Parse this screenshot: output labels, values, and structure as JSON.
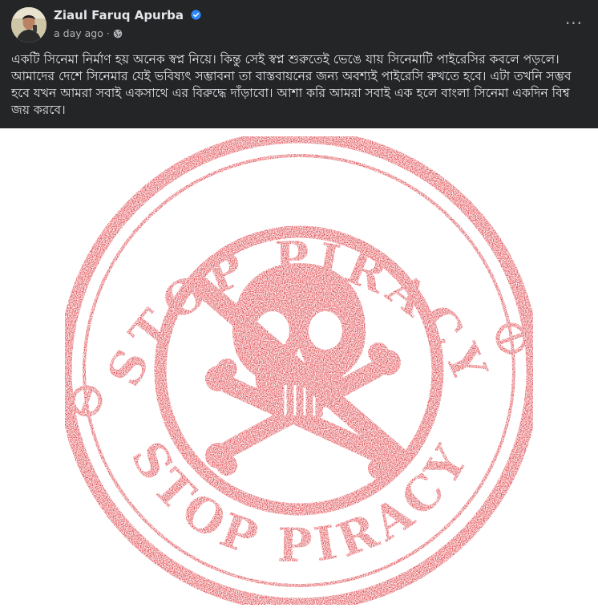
{
  "post": {
    "author": "Ziaul Faruq Apurba",
    "verified_icon": "verified-badge-icon",
    "timestamp": "a day ago",
    "separator": "·",
    "audience_icon": "globe-icon",
    "more_label": "···",
    "text": "একটি সিনেমা নির্মাণ হয় অনেক স্বপ্ন নিয়ে। কিন্তু সেই স্বপ্ন শুরুতেই ভেঙে যায় সিনেমাটি পাইরেসির কবলে পড়লে। আমাদের দেশে সিনেমার যেই ভবিষ্যৎ সম্ভাবনা তা বাস্তবায়নের জন্য অবশ্যই পাইরেসি রুখতে হবে। এটা তখনি সম্ভব হবে যখন আমরা সবাই একসাথে এর বিরুদ্ধে দাঁড়াবো। আশা করি আমরা সবাই এক হলে বাংলা সিনেমা একদিন বিশ্ব জয় করবে।"
  },
  "stamp": {
    "top_text": "STOP PIRACY",
    "bottom_text": "STOP PIRACY",
    "color": "#d71920",
    "icon": "skull-crossbones-icon",
    "symbol_icon": "prohibition-icon"
  },
  "colors": {
    "background": "#242526",
    "text_primary": "#e4e6eb",
    "text_secondary": "#b0b3b8",
    "verified": "#2d88ff",
    "stamp_red": "#d71920"
  }
}
